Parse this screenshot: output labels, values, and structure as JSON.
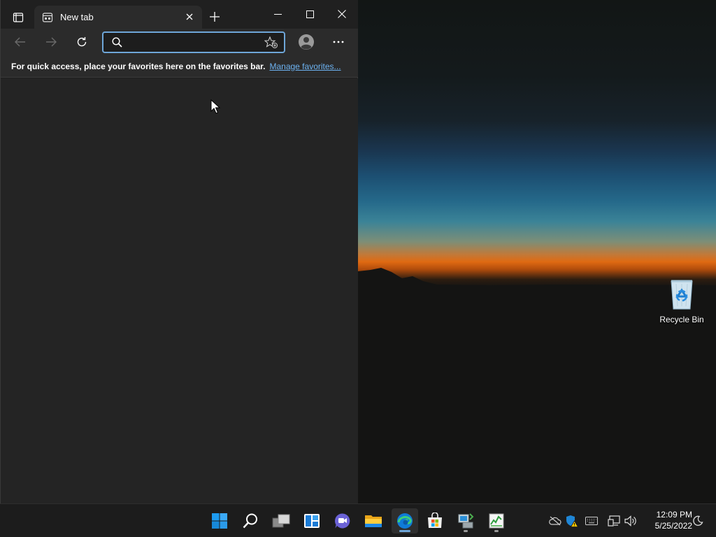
{
  "browser": {
    "tab_title": "New tab",
    "address": {
      "value": "",
      "placeholder": ""
    },
    "favorites_bar": {
      "message": "For quick access, place your favorites here on the favorites bar.",
      "link": "Manage favorites..."
    }
  },
  "desktop": {
    "icons": [
      {
        "label": "Recycle Bin",
        "icon": "recycle-bin-icon"
      }
    ]
  },
  "taskbar": {
    "pinned": [
      "windows-start-icon",
      "search-icon",
      "task-view-icon",
      "widgets-icon",
      "teams-chat-icon",
      "file-explorer-icon",
      "edge-icon",
      "microsoft-store-icon",
      "network-app-icon",
      "task-manager-icon"
    ],
    "active_app": "edge-icon",
    "tray": [
      "onedrive-offline-icon",
      "security-warning-icon",
      "keyboard-icon",
      "network-icon",
      "volume-icon",
      "focus-assist-icon"
    ],
    "clock": {
      "time": "12:09 PM",
      "date": "5/25/2022"
    }
  },
  "colors": {
    "accent": "#6ea6d8",
    "link": "#6db3f2",
    "window_bg": "#202020",
    "toolbar_bg": "#2b2b2b",
    "taskbar_bg": "#1c1c1c"
  }
}
